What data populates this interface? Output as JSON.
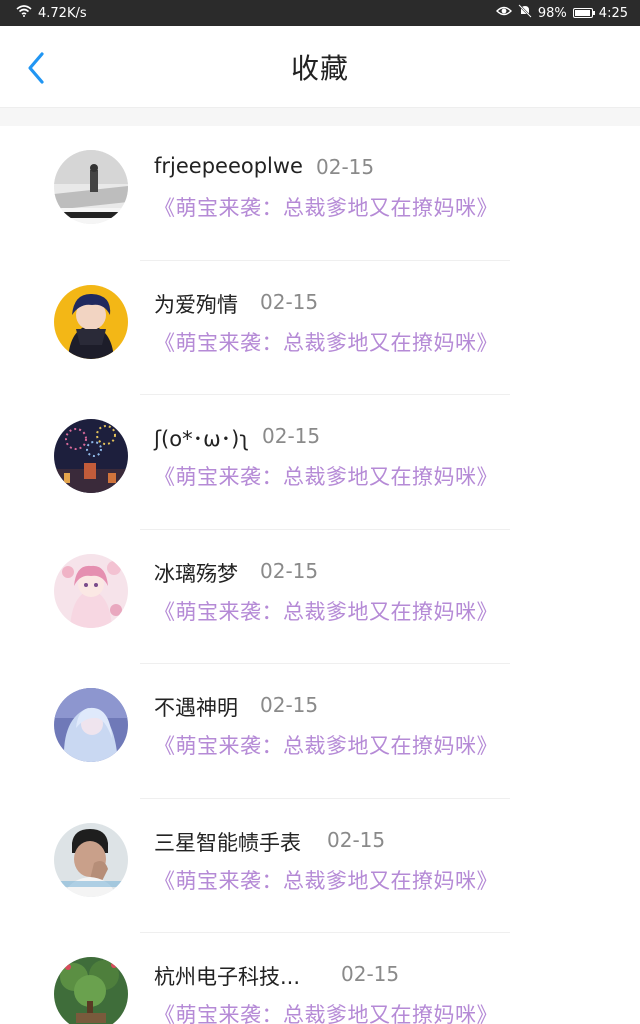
{
  "status_bar": {
    "speed": "4.72K/s",
    "battery": "98%",
    "time": "4:25",
    "icons": [
      "wifi-icon",
      "eye-icon",
      "mute-icon",
      "battery-icon"
    ]
  },
  "header": {
    "title": "收藏",
    "back_icon": "chevron-left-icon",
    "accent_color": "#2196f3"
  },
  "book_color": "#b58ad6",
  "items": [
    {
      "name": "frjeepeeoplwe",
      "date": "02-15",
      "book": "《萌宝来袭：总裁爹地又在撩妈咪》",
      "avatar": "street-photo"
    },
    {
      "name": "为爱殉情",
      "date": "02-15",
      "book": "《萌宝来袭：总裁爹地又在撩妈咪》",
      "avatar": "anime-boy-yellow"
    },
    {
      "name": "ʃ(o*･ω･)ʅ",
      "date": "02-15",
      "book": "《萌宝来袭：总裁爹地又在撩妈咪》",
      "avatar": "fireworks-night"
    },
    {
      "name": "冰璃殇梦",
      "date": "02-15",
      "book": "《萌宝来袭：总裁爹地又在撩妈咪》",
      "avatar": "anime-girl-pink"
    },
    {
      "name": "不遇神明",
      "date": "02-15",
      "book": "《萌宝来袭：总裁爹地又在撩妈咪》",
      "avatar": "anime-girl-blue"
    },
    {
      "name": "三星智能帻手表",
      "date": "02-15",
      "book": "《萌宝来袭：总裁爹地又在撩妈咪》",
      "avatar": "boy-photo"
    },
    {
      "name": "杭州电子科技...",
      "date": "02-15",
      "book": "《萌宝来袭：总裁爹地又在撩妈咪》",
      "avatar": "bonsai-plant"
    }
  ]
}
